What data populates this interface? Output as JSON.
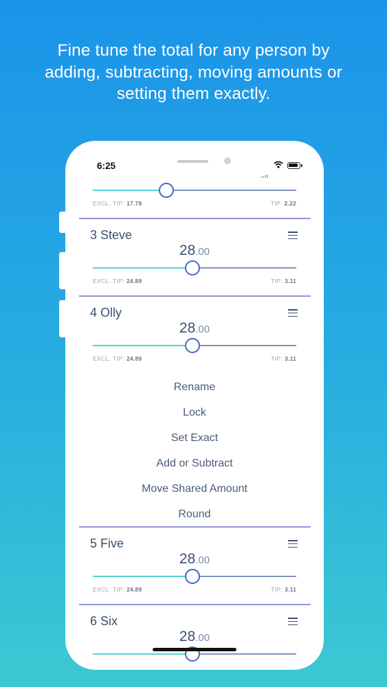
{
  "headline": {
    "line1": "Fine tune the total for any person by",
    "line2": "adding, subtracting, moving amounts or",
    "line3": "setting them exactly."
  },
  "status_bar": {
    "time": "6:25"
  },
  "rows": [
    {
      "name": "",
      "amount_int": "",
      "amount_dec": "",
      "slider_fraction": 0.36,
      "excl_tip_label": "EXCL. TIP:",
      "excl_tip_value": "17.78",
      "tip_label": "TIP:",
      "tip_value": "2.22"
    },
    {
      "name": "3 Steve",
      "amount_int": "28",
      "amount_dec": ".00",
      "slider_fraction": 0.49,
      "excl_tip_label": "EXCL. TIP:",
      "excl_tip_value": "24.89",
      "tip_label": "TIP:",
      "tip_value": "3.11"
    },
    {
      "name": "4 Olly",
      "amount_int": "28",
      "amount_dec": ".00",
      "slider_fraction": 0.49,
      "excl_tip_label": "EXCL. TIP:",
      "excl_tip_value": "24.89",
      "tip_label": "TIP:",
      "tip_value": "3.11"
    },
    {
      "name": "5 Five",
      "amount_int": "28",
      "amount_dec": ".00",
      "slider_fraction": 0.49,
      "excl_tip_label": "EXCL. TIP:",
      "excl_tip_value": "24.89",
      "tip_label": "TIP:",
      "tip_value": "3.11"
    },
    {
      "name": "6 Six",
      "amount_int": "28",
      "amount_dec": ".00",
      "slider_fraction": 0.49
    }
  ],
  "actions": [
    "Rename",
    "Lock",
    "Set Exact",
    "Add or Subtract",
    "Move Shared Amount",
    "Round"
  ],
  "colors": {
    "bg_top": "#1b93ea",
    "bg_bottom": "#3cc9d2",
    "text_primary": "#3b4f73",
    "slider_track": "#7f93bd",
    "slider_fill": "#53d3db",
    "slider_knob": "#4466c4",
    "divider": "#8f97d8"
  }
}
